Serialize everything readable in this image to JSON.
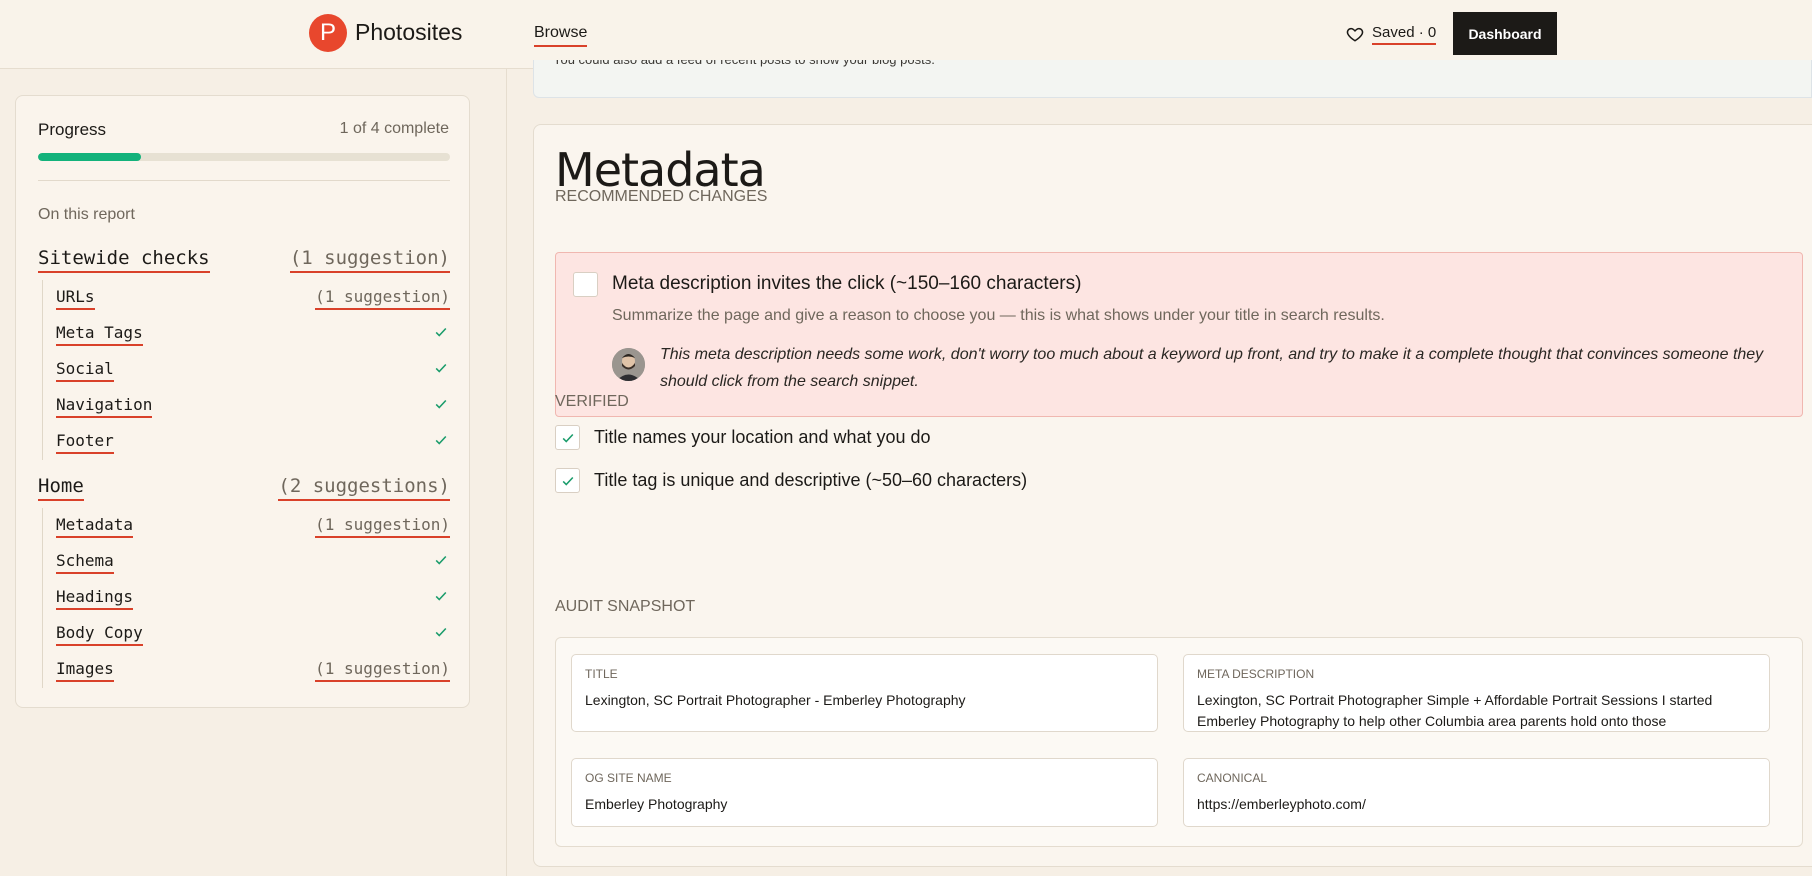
{
  "nav": {
    "logo_letter": "P",
    "brand": "Photosites",
    "browse": "Browse",
    "saved": "Saved · 0",
    "dashboard": "Dashboard"
  },
  "sidebar": {
    "progress_label": "Progress",
    "progress_count": "1 of 4 complete",
    "progress_fraction": 0.25,
    "on_report": "On this report",
    "sections": [
      {
        "title": "Sitewide checks",
        "count": "(1 suggestion)",
        "items": [
          {
            "title": "URLs",
            "count": "(1 suggestion)"
          },
          {
            "title": "Meta Tags",
            "status": "check"
          },
          {
            "title": "Social",
            "status": "check"
          },
          {
            "title": "Navigation",
            "status": "check"
          },
          {
            "title": "Footer",
            "status": "check"
          }
        ]
      },
      {
        "title": "Home",
        "count": "(2 suggestions)",
        "items": [
          {
            "title": "Metadata",
            "count": "(1 suggestion)"
          },
          {
            "title": "Schema",
            "status": "check"
          },
          {
            "title": "Headings",
            "status": "check"
          },
          {
            "title": "Body Copy",
            "status": "check"
          },
          {
            "title": "Images",
            "count": "(1 suggestion)"
          }
        ]
      }
    ]
  },
  "main": {
    "info_text": "You could also add a feed of recent posts to show your blog posts.",
    "heading": "Metadata",
    "recommended_label": "RECOMMENDED CHANGES",
    "recommendation": {
      "title": "Meta description invites the click (~150–160 characters)",
      "subtitle": "Summarize the page and give a reason to choose you — this is what shows under your title in search results.",
      "comment": "This meta description needs some work, don't worry too much about a keyword up front, and try to make it a complete thought that convinces someone they should click from the search snippet."
    },
    "verified_label": "VERIFIED",
    "verified": [
      "Title names your location and what you do",
      "Title tag is unique and descriptive (~50–60 characters)"
    ],
    "snapshot_label": "AUDIT SNAPSHOT",
    "snapshot": [
      {
        "key": "TITLE",
        "value": "Lexington, SC Portrait Photographer - Emberley Photography"
      },
      {
        "key": "META DESCRIPTION",
        "value": "Lexington, SC Portrait Photographer Simple + Affordable Portrait Sessions I started Emberley Photography to help other Columbia area parents hold onto those"
      },
      {
        "key": "OG SITE NAME",
        "value": "Emberley Photography"
      },
      {
        "key": "CANONICAL",
        "value": "https://emberleyphoto.com/"
      }
    ]
  },
  "colors": {
    "accent_red": "#d9412a",
    "progress_green": "#13b27b",
    "check_green": "#1a9c6b"
  }
}
